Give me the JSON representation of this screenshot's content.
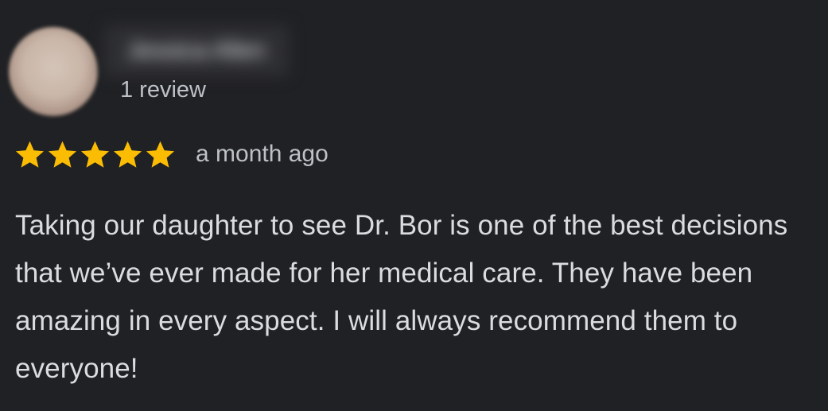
{
  "review": {
    "reviewer_name": "Jessica Allen",
    "review_count": "1 review",
    "rating": 5,
    "rating_max": 5,
    "date": "a month ago",
    "text": "Taking our daughter to see Dr. Bor is one of the best decisions that we’ve ever made for her medical care. They have been amazing in every aspect. I will always recommend them to everyone!"
  },
  "colors": {
    "background": "#202124",
    "star": "#fbbc04",
    "text_primary": "#dadce0",
    "text_secondary": "#bdc1c6"
  },
  "icons": {
    "star": "star-icon",
    "avatar": "avatar"
  }
}
